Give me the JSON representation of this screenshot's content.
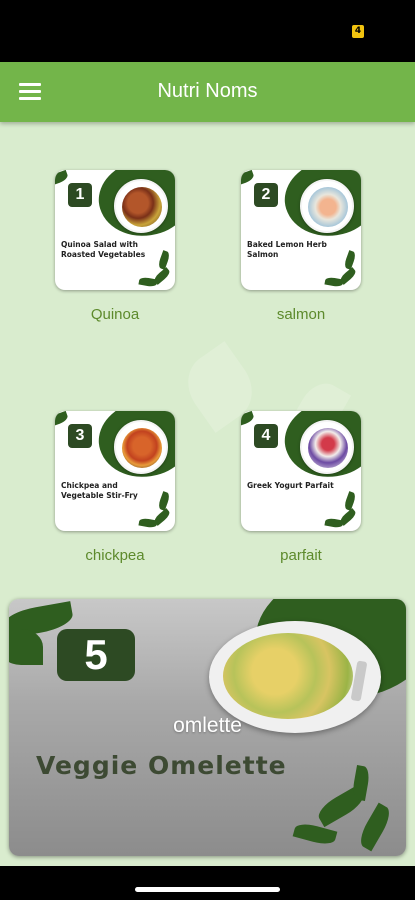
{
  "status_bar": {
    "battery_text": "4"
  },
  "app_bar": {
    "title": "Nutri Noms",
    "menu_icon": "hamburger-menu-icon"
  },
  "recipes": [
    {
      "number": "1",
      "card_text": "Quinoa Salad with Roasted Vegetables",
      "caption": "Quinoa"
    },
    {
      "number": "2",
      "card_text": "Baked Lemon Herb Salmon",
      "caption": "salmon"
    },
    {
      "number": "3",
      "card_text": "Chickpea and Vegetable Stir-Fry",
      "caption": "chickpea"
    },
    {
      "number": "4",
      "card_text": "Greek Yogurt Parfait",
      "caption": "parfait"
    }
  ],
  "featured": {
    "number": "5",
    "dish_title": "Veggie Omelette",
    "caption": "omlette"
  },
  "colors": {
    "app_bar": "#73b54a",
    "background": "#d9ecce",
    "caption": "#5d8a2c",
    "dark_green": "#2f5e1f"
  }
}
